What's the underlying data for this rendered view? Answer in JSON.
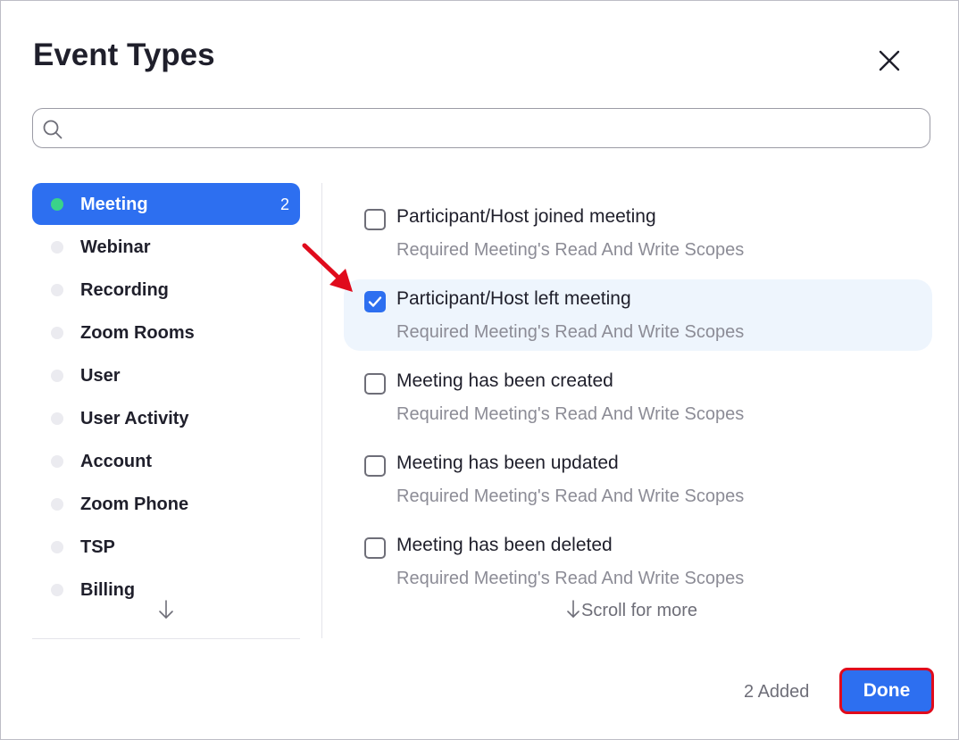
{
  "dialog": {
    "title": "Event Types",
    "close_icon": "close-icon"
  },
  "search": {
    "value": "",
    "placeholder": "",
    "icon": "search-icon"
  },
  "sidebar": {
    "items": [
      {
        "label": "Meeting",
        "count": "2",
        "active": true
      },
      {
        "label": "Webinar",
        "count": ""
      },
      {
        "label": "Recording",
        "count": ""
      },
      {
        "label": "Zoom Rooms",
        "count": ""
      },
      {
        "label": "User",
        "count": ""
      },
      {
        "label": "User Activity",
        "count": ""
      },
      {
        "label": "Account",
        "count": ""
      },
      {
        "label": "Zoom Phone",
        "count": ""
      },
      {
        "label": "TSP",
        "count": ""
      },
      {
        "label": "Billing",
        "count": ""
      }
    ],
    "scroll_icon": "arrow-down-icon"
  },
  "events": [
    {
      "label": "Participant/Host joined meeting",
      "sub": "Required Meeting's Read And Write Scopes",
      "checked": false
    },
    {
      "label": "Participant/Host left meeting",
      "sub": "Required Meeting's Read And Write Scopes",
      "checked": true
    },
    {
      "label": "Meeting has been created",
      "sub": "Required Meeting's Read And Write Scopes",
      "checked": false
    },
    {
      "label": "Meeting has been updated",
      "sub": "Required Meeting's Read And Write Scopes",
      "checked": false
    },
    {
      "label": "Meeting has been deleted",
      "sub": "Required Meeting's Read And Write Scopes",
      "checked": false
    }
  ],
  "scroll_more": "Scroll for more",
  "footer": {
    "added_text": "2 Added",
    "done_label": "Done"
  },
  "colors": {
    "accent": "#2d6ff0",
    "active_dot": "#3ad38a",
    "selected_row": "#eef5fd",
    "annotation": "#e00b1c"
  }
}
